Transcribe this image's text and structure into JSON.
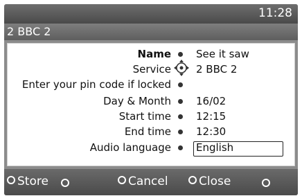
{
  "header": {
    "clock": "11:28",
    "channel_title": "2 BBC 2"
  },
  "form": {
    "rows": [
      {
        "label": "Name",
        "value": "See it saw"
      },
      {
        "label": "Service",
        "value": "2 BBC 2"
      },
      {
        "label": "Enter your pin code if locked",
        "value": ""
      },
      {
        "label": "Day & Month",
        "value": "16/02"
      },
      {
        "label": "Start time",
        "value": "12:15"
      },
      {
        "label": "End time",
        "value": "12:30"
      },
      {
        "label": "Audio language",
        "value": "English"
      }
    ]
  },
  "footer": {
    "store": "Store",
    "cancel": "Cancel",
    "close": "Close"
  },
  "icons": {
    "navigation": "dpad-icon",
    "bullet": "dot-icon"
  },
  "colors": {
    "background": "#8c8c8c",
    "panel": "#ffffff",
    "text": "#111111",
    "footer_text": "#ffffff"
  }
}
